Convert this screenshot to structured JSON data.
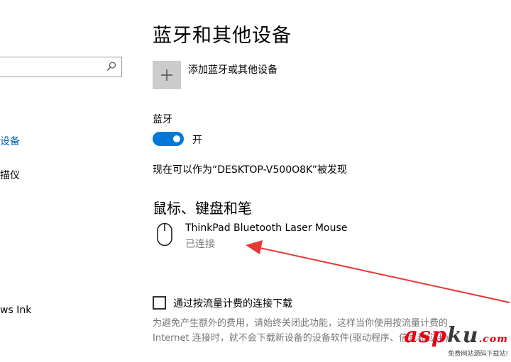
{
  "sidebar": {
    "items": [
      {
        "label": "设备",
        "active": true
      },
      {
        "label": "描仪",
        "active": false
      },
      {
        "label": "ws Ink",
        "active": false
      }
    ]
  },
  "main": {
    "title": "蓝牙和其他设备",
    "add_device_label": "添加蓝牙或其他设备",
    "bluetooth_heading": "蓝牙",
    "bluetooth_toggle": {
      "state": "开",
      "on": true
    },
    "discoverable_text": "现在可以作为“DESKTOP-V500O8K”被发现",
    "section_title": "鼠标、键盘和笔",
    "device": {
      "name": "ThinkPad Bluetooth Laser Mouse",
      "status": "已连接",
      "icon": "mouse-icon"
    },
    "metered_checkbox_label": "通过按流量计费的连接下载",
    "metered_description": "为避免产生额外的费用，请始终关闭此功能，这样当你使用按流量计费的 Internet 连接时，就不会下载新设备的设备软件(驱动程序、信息和应用)。"
  },
  "watermark": {
    "logo_red": "asp",
    "logo_dark": "ku",
    "logo_suffix": ".com",
    "subtitle": "免费网站源码下载站!"
  },
  "colors": {
    "accent": "#0078d7",
    "active_link": "#0063b1",
    "secondary_text": "#767676",
    "annotation_arrow": "#e53935"
  }
}
